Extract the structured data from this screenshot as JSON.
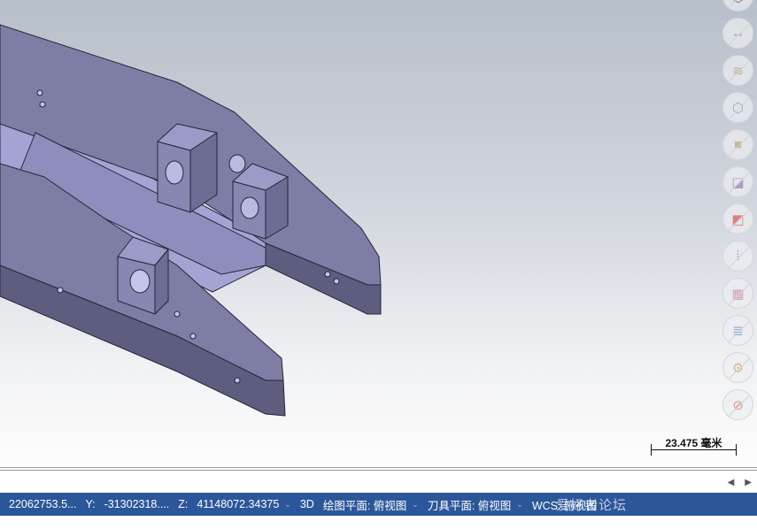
{
  "toolbar": {
    "items": [
      {
        "name": "view-icon",
        "glyph": "◎"
      },
      {
        "name": "measure-icon",
        "glyph": "↔"
      },
      {
        "name": "surface-icon",
        "glyph": "≋"
      },
      {
        "name": "wireframe-box-icon",
        "glyph": "⬡"
      },
      {
        "name": "solid-box-icon",
        "glyph": "■"
      },
      {
        "name": "back-square-icon",
        "glyph": "◪"
      },
      {
        "name": "front-square-icon",
        "glyph": "◩"
      },
      {
        "name": "level-tag-icon",
        "glyph": "⁞"
      },
      {
        "name": "color-grid-icon",
        "glyph": "▦"
      },
      {
        "name": "layers-icon",
        "glyph": "≣"
      },
      {
        "name": "gear-icon",
        "glyph": "⚙"
      },
      {
        "name": "prohibit-icon",
        "glyph": "⊘"
      }
    ]
  },
  "scale_bar": {
    "label": "23.475 毫米"
  },
  "status": {
    "x": "22062753.5...",
    "y_label": "Y:",
    "y": "-31302318....",
    "z_label": "Z:",
    "z": "41148072.34375",
    "mode": "3D",
    "plane": "绘图平面: 俯视图",
    "tool_plane": "刀具平面: 俯视图",
    "wcs": "WCS: 俯视图"
  },
  "watermark": "爱好者论坛 WWW.UGSNX.COM",
  "colors": {
    "status_bg": "#2b579a",
    "model_face": "#7b7ba3"
  }
}
